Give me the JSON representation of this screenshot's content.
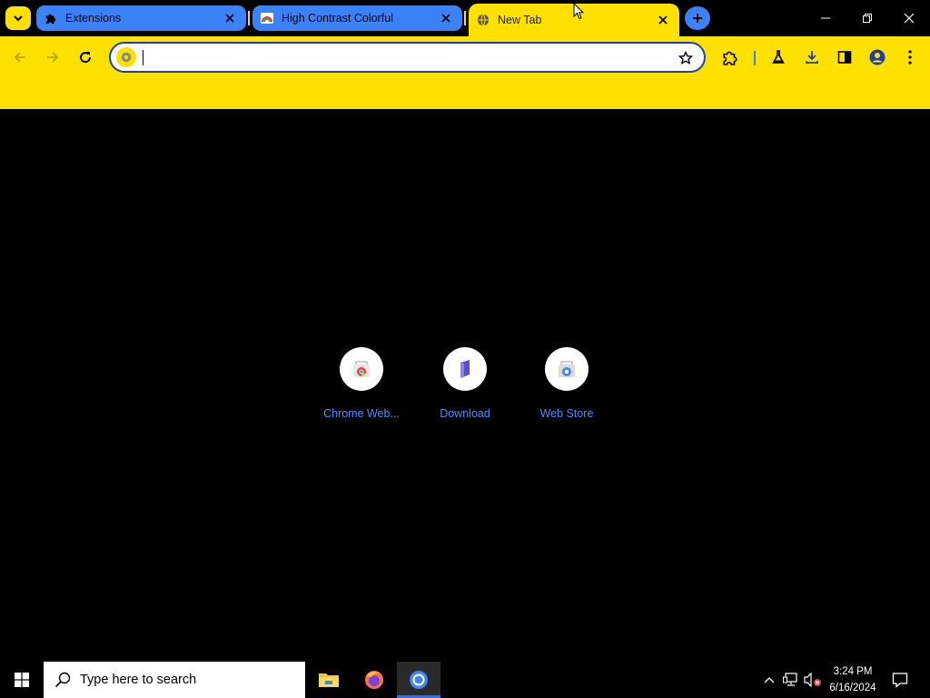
{
  "browser": {
    "tabs": [
      {
        "title": "Extensions",
        "favicon": "puzzle-icon",
        "active": false
      },
      {
        "title": "High Contrast Colorful",
        "favicon": "rainbow-icon",
        "active": false
      },
      {
        "title": "New Tab",
        "favicon": "globe-icon",
        "active": true
      }
    ],
    "omnibox": {
      "value": "",
      "placeholder": ""
    },
    "colors": {
      "toolbar": "#ffe100",
      "tab_inactive": "#3b82f6",
      "content_bg": "#000000",
      "link": "#4d8dff"
    }
  },
  "new_tab": {
    "shortcuts": [
      {
        "label": "Chrome Web...",
        "icon": "chrome-web-store-icon"
      },
      {
        "label": "Download",
        "icon": "download-app-icon"
      },
      {
        "label": "Web Store",
        "icon": "web-store-icon"
      }
    ]
  },
  "taskbar": {
    "search_placeholder": "Type here to search",
    "apps": [
      "file-explorer-icon",
      "firefox-icon",
      "chrome-icon"
    ],
    "clock": {
      "time": "3:24 PM",
      "date": "6/16/2024"
    }
  }
}
